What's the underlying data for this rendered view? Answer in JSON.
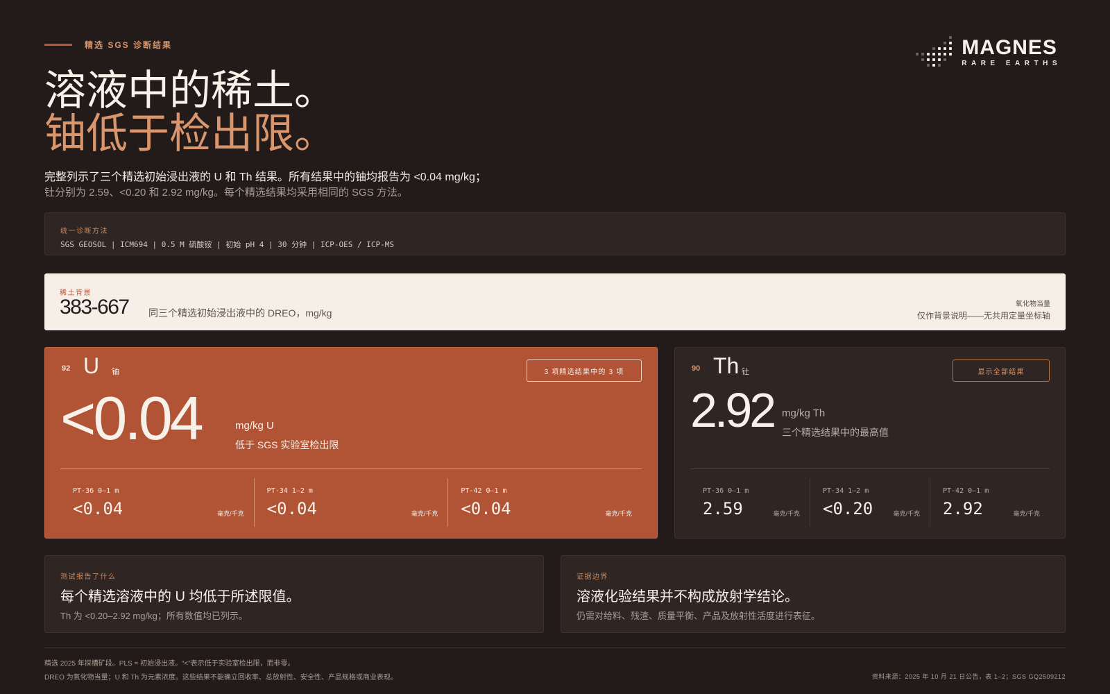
{
  "header": {
    "eyebrow": "精选 SGS 诊断结果",
    "title_line1": "溶液中的稀土。",
    "title_line2": "铀低于检出限。",
    "lead_line1": "完整列示了三个精选初始浸出液的 U 和 Th 结果。所有结果中的铀均报告为 <0.04 mg/kg；",
    "lead_line2": "钍分别为 2.59、<0.20 和 2.92 mg/kg。每个精选结果均采用相同的 SGS 方法。"
  },
  "logo": {
    "name": "MAGNES",
    "tagline": "RARE EARTHS"
  },
  "method": {
    "label": "统一诊断方法",
    "text": "SGS GEOSOL | ICM694 | 0.5 M 硫酸铵 | 初始 pH 4 | 30 分钟 | ICP-OES / ICP-MS"
  },
  "rare_earth_background": {
    "label": "稀土背景",
    "range": "383-667",
    "description": "同三个精选初始浸出液中的 DREO，mg/kg",
    "right_label": "氧化物当量",
    "right_note": "仅作背景说明——无共用定量坐标轴"
  },
  "uranium": {
    "atomic_number": "92",
    "symbol": "U",
    "name": "铀",
    "pill": "3 项精选结果中的 3 项",
    "headline_value": "<0.04",
    "unit": "mg/kg U",
    "note": "低于 SGS 实验室检出限",
    "samples": [
      {
        "label": "PT-36 0–1 m",
        "value": "<0.04",
        "unit": "毫克/千克"
      },
      {
        "label": "PT-34 1–2 m",
        "value": "<0.04",
        "unit": "毫克/千克"
      },
      {
        "label": "PT-42 0–1 m",
        "value": "<0.04",
        "unit": "毫克/千克"
      }
    ]
  },
  "thorium": {
    "atomic_number": "90",
    "symbol": "Th",
    "name": "钍",
    "pill": "显示全部结果",
    "headline_value": "2.92",
    "unit": "mg/kg Th",
    "note": "三个精选结果中的最高值",
    "samples": [
      {
        "label": "PT-36 0–1 m",
        "value": "2.59",
        "unit": "毫克/千克"
      },
      {
        "label": "PT-34 1–2 m",
        "value": "<0.20",
        "unit": "毫克/千克"
      },
      {
        "label": "PT-42 0–1 m",
        "value": "2.92",
        "unit": "毫克/千克"
      }
    ]
  },
  "panels": {
    "reported": {
      "label": "测试报告了什么",
      "title": "每个精选溶液中的 U 均低于所述限值。",
      "description": "Th 为 <0.20–2.92 mg/kg；所有数值均已列示。"
    },
    "boundary": {
      "label": "证据边界",
      "title": "溶液化验结果并不构成放射学结论。",
      "description": "仍需对给料、残渣、质量平衡、产品及放射性活度进行表征。"
    }
  },
  "footer": {
    "line1": "精选 2025 年探槽矿段。PLS = 初始浸出液。“<”表示低于实验室检出限，而非零。",
    "line2": "DREO 为氧化物当量；U 和 Th 为元素浓度。这些结果不能确立回收率、总放射性、安全性、产品规格或商业表现。",
    "source": "资料来源：2025 年 10 月 21 日公告，表 1–2；SGS GQ2509212"
  },
  "colors": {
    "background": "#231b1a",
    "accent": "#b15436",
    "accent_text": "#d9966c",
    "panel": "#2f2523",
    "light_band": "#f5efe7"
  }
}
